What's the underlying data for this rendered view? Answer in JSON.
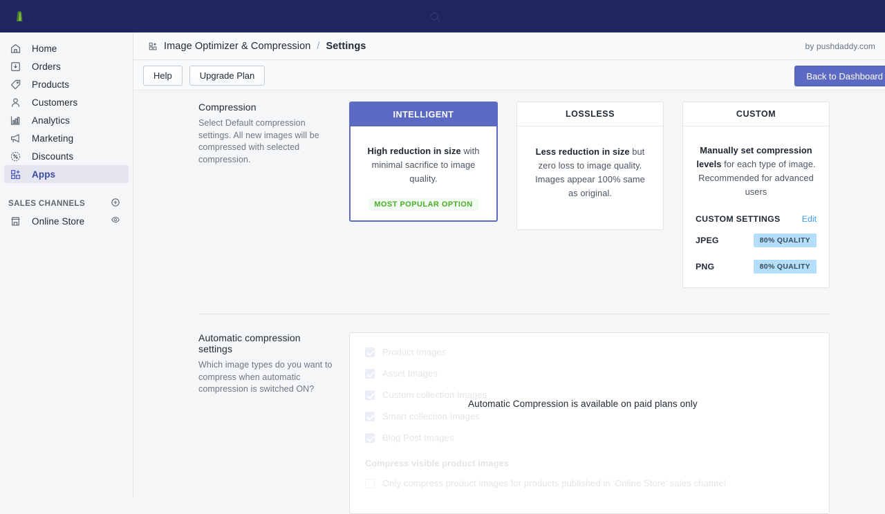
{
  "topbar": {
    "logo_icon": "shopify-logo-icon",
    "search_icon": "search-icon",
    "search_text": "",
    "store_name": "",
    "avatar_text": ""
  },
  "sidebar": {
    "items": [
      {
        "label": "Home",
        "icon": "home-icon",
        "active": false
      },
      {
        "label": "Orders",
        "icon": "orders-icon",
        "active": false
      },
      {
        "label": "Products",
        "icon": "products-tag-icon",
        "active": false
      },
      {
        "label": "Customers",
        "icon": "customers-person-icon",
        "active": false
      },
      {
        "label": "Analytics",
        "icon": "analytics-bar-chart-icon",
        "active": false
      },
      {
        "label": "Marketing",
        "icon": "marketing-megaphone-icon",
        "active": false
      },
      {
        "label": "Discounts",
        "icon": "discounts-percent-icon",
        "active": false
      },
      {
        "label": "Apps",
        "icon": "apps-grid-icon",
        "active": true
      }
    ],
    "sales_channels": {
      "label": "SALES CHANNELS",
      "add_icon": "plus-circle-icon",
      "items": [
        {
          "label": "Online Store",
          "icon": "storefront-icon",
          "trailing_icon": "eye-icon"
        }
      ]
    }
  },
  "header": {
    "app_icon": "apps-grid-icon",
    "app_name": "Image Optimizer & Compression",
    "separator": "/",
    "page": "Settings",
    "by_line": "by pushdaddy.com"
  },
  "actions": {
    "help_label": "Help",
    "upgrade_label": "Upgrade Plan",
    "back_label": "Back to Dashboard",
    "primary_color": "#5c6ac4"
  },
  "compression": {
    "title": "Compression",
    "description": "Select Default compression settings. All new images will be compressed with selected compression.",
    "cards": [
      {
        "id": "intelligent",
        "head": "INTELLIGENT",
        "selected": true,
        "body_bold": "High reduction in size",
        "body_rest": " with minimal sacrifice to image quality.",
        "badge": "MOST POPULAR OPTION",
        "badge_color": "#4caf28"
      },
      {
        "id": "lossless",
        "head": "LOSSLESS",
        "selected": false,
        "body_bold": "Less reduction in size",
        "body_rest": " but zero loss to image quality. Images appear 100% same as original.",
        "badge": null
      },
      {
        "id": "custom",
        "head": "CUSTOM",
        "selected": false,
        "body_bold": "Manually set compression levels",
        "body_rest": " for each type of image. Recommended for advanced users",
        "badge": null
      }
    ],
    "custom_settings": {
      "title": "CUSTOM SETTINGS",
      "edit_label": "Edit",
      "edit_color": "#3d9ae8",
      "rows": [
        {
          "label": "JPEG",
          "value": "80% QUALITY"
        },
        {
          "label": "PNG",
          "value": "80% QUALITY"
        }
      ],
      "badge_bg": "#b4dffc"
    }
  },
  "automatic": {
    "title": "Automatic compression settings",
    "description": "Which image types do you want to compress when automatic compression is switched ON?",
    "checkboxes": [
      {
        "label": "Product Images",
        "checked": true
      },
      {
        "label": "Asset Images",
        "checked": true
      },
      {
        "label": "Custom collection Images",
        "checked": true
      },
      {
        "label": "Smart collection Images",
        "checked": true
      },
      {
        "label": "Blog Post Images",
        "checked": true
      }
    ],
    "group_title": "Compress visible product images",
    "extra_checkbox": {
      "label": "Only compress product images for products published in 'Online Store' sales channel",
      "checked": false
    },
    "overlay_message": "Automatic Compression is available on paid plans only"
  }
}
